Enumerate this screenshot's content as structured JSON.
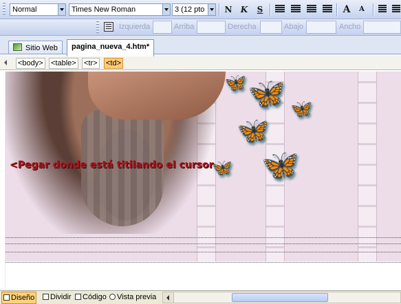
{
  "formatting_toolbar": {
    "style_value": "Normal",
    "font_value": "Times New Roman",
    "size_value": "3  (12 pto",
    "bold_label": "N",
    "italic_label": "K",
    "underline_label": "S",
    "grow_label": "A",
    "shrink_label": "A",
    "bold_icon": "bold-icon",
    "italic_icon": "italic-icon",
    "underline_icon": "underline-icon"
  },
  "position_toolbar": {
    "left_label": "Izquierda",
    "top_label": "Arriba",
    "right_label": "Derecha",
    "bottom_label": "Abajo",
    "width_label": "Ancho",
    "icon": "position-icon"
  },
  "tabs": [
    {
      "label": "Sitio Web",
      "icon": "website-icon"
    },
    {
      "label": "pagina_nueva_4.htm*"
    }
  ],
  "tag_selector": [
    "<body>",
    "<table>",
    "<tr>",
    "<td>"
  ],
  "canvas": {
    "notice": "<Pegar donde está titilando el cursor",
    "butterfly_glyph": "🦋",
    "banner_color": "#ecdde9",
    "notice_color": "#a8151c",
    "butterfly_color": "#35e0e6"
  },
  "views": [
    {
      "label": "Diseño",
      "active": true
    },
    {
      "label": "Dividir"
    },
    {
      "label": "Código"
    },
    {
      "label": "Vista previa"
    }
  ]
}
